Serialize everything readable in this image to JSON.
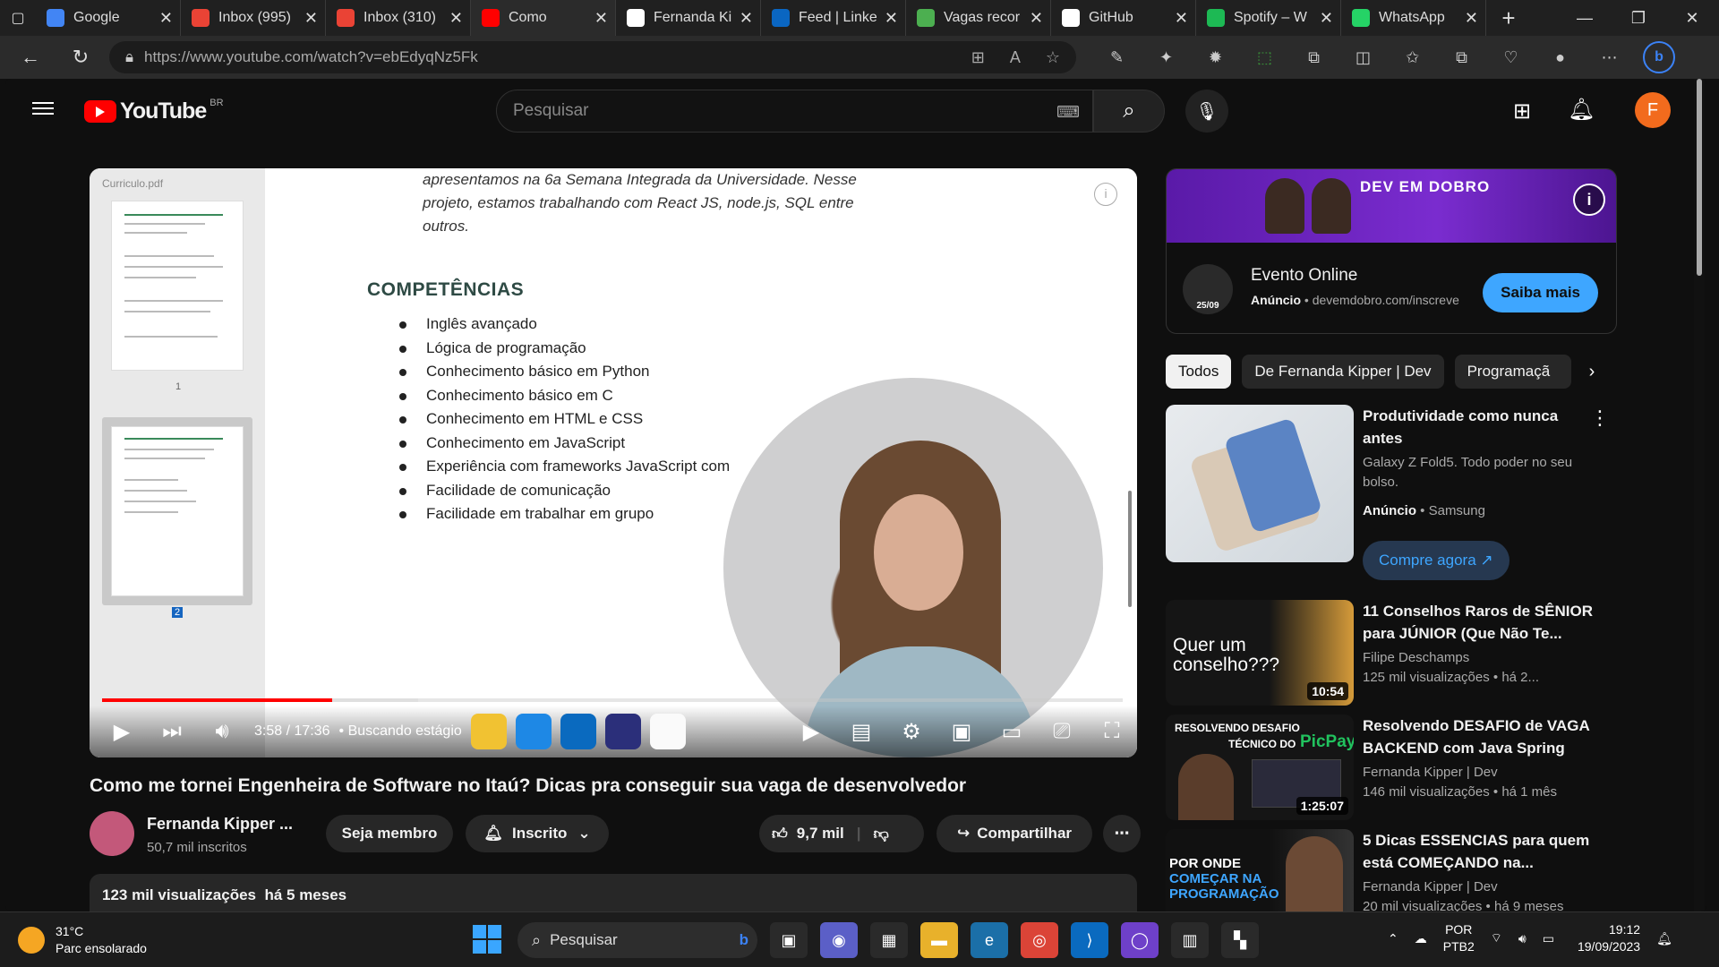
{
  "browser": {
    "tabs": [
      {
        "label": "Google",
        "icon": "google-icon",
        "color": "#4285f4"
      },
      {
        "label": "Inbox (995)",
        "icon": "gmail-icon",
        "color": "#ea4335"
      },
      {
        "label": "Inbox (310)",
        "icon": "gmail-icon",
        "color": "#ea4335"
      },
      {
        "label": "Como",
        "icon": "youtube-icon",
        "color": "#ff0000",
        "active": true
      },
      {
        "label": "Fernanda Ki",
        "icon": "notion-icon",
        "color": "#ffffff"
      },
      {
        "label": "Feed | Linke",
        "icon": "linkedin-icon",
        "color": "#0a66c2"
      },
      {
        "label": "Vagas recor",
        "icon": "page-icon",
        "color": "#4caf50"
      },
      {
        "label": "GitHub",
        "icon": "github-icon",
        "color": "#ffffff"
      },
      {
        "label": "Spotify – W",
        "icon": "spotify-icon",
        "color": "#1db954"
      },
      {
        "label": "WhatsApp",
        "icon": "whatsapp-icon",
        "color": "#25d366"
      }
    ],
    "url": "https://www.youtube.com/watch?v=ebEdyqNz5Fk"
  },
  "youtube": {
    "logo_text": "YouTube",
    "region": "BR",
    "search_placeholder": "Pesquisar",
    "avatar_letter": "F"
  },
  "player": {
    "pdf_name": "Curriculo.pdf",
    "page1": "1",
    "page2": "2",
    "intro_lines": [
      "apresentamos na 6a Semana Integrada da Universidade. Nesse",
      "projeto, estamos trabalhando com React JS, node.js, SQL entre",
      "outros."
    ],
    "section_heading": "COMPETÊNCIAS",
    "skills": [
      "Inglês avançado",
      "Lógica de programação",
      "Conhecimento básico em Python",
      "Conhecimento básico em C",
      "Conhecimento em HTML e CSS",
      "Conhecimento em JavaScript",
      "Experiência com frameworks JavaScript com",
      "Facilidade de comunicação",
      "Facilidade em trabalhar em grupo"
    ],
    "time": "3:58 / 17:36",
    "chapter": "• Buscando estágio",
    "progress_played": 0.2257,
    "progress_buffered": 0.31
  },
  "video": {
    "title": "Como me tornei Engenheira de Software no Itaú? Dicas pra conseguir sua vaga de desenvolvedor",
    "channel": "Fernanda Kipper ...",
    "subscribers": "50,7 mil inscritos",
    "join_label": "Seja membro",
    "subscribed_label": "Inscrito",
    "likes": "9,7 mil",
    "share_label": "Compartilhar",
    "views": "123 mil visualizações",
    "date": "há 5 meses"
  },
  "ad": {
    "banner_text": "DEV EM DOBRO",
    "title": "Evento Online",
    "label": "Anúncio",
    "domain": "devemdobro.com/inscreve",
    "logo_date": "25/09",
    "cta": "Saiba mais"
  },
  "chips": [
    "Todos",
    "De Fernanda Kipper | Dev",
    "Programaçã"
  ],
  "recommendations": [
    {
      "title": "Produtividade como nunca antes",
      "line1": "Galaxy Z Fold5. Todo poder no seu",
      "line2": "bolso.",
      "ad_label": "Anúncio",
      "advertiser": "Samsung",
      "cta": "Compre agora"
    },
    {
      "title": "11 Conselhos Raros de SÊNIOR para JÚNIOR (Que Não Te...",
      "channel": "Filipe Deschamps",
      "meta": "125 mil visualizações  •  há 2...",
      "duration": "10:54",
      "thumb_text": "Quer um conselho???"
    },
    {
      "title": "Resolvendo DESAFIO de VAGA BACKEND com Java Spring",
      "channel": "Fernanda Kipper | Dev",
      "meta": "146 mil visualizações  •  há 1 mês",
      "duration": "1:25:07",
      "thumb_text1": "RESOLVENDO DESAFIO",
      "thumb_text2": "TÉCNICO DO",
      "thumb_text3": "PicPay"
    },
    {
      "title": "5 Dicas ESSENCIAS para quem está COMEÇANDO na...",
      "channel": "Fernanda Kipper | Dev",
      "meta": "20 mil visualizações  •  há 9 meses",
      "thumb_text1": "POR ONDE",
      "thumb_text2": "COMEÇAR NA",
      "thumb_text3": "PROGRAMAÇÃO"
    }
  ],
  "taskbar": {
    "temp": "31°C",
    "weather": "Parc ensolarado",
    "search": "Pesquisar",
    "lang1": "POR",
    "lang2": "PTB2",
    "time": "19:12",
    "date": "19/09/2023"
  }
}
